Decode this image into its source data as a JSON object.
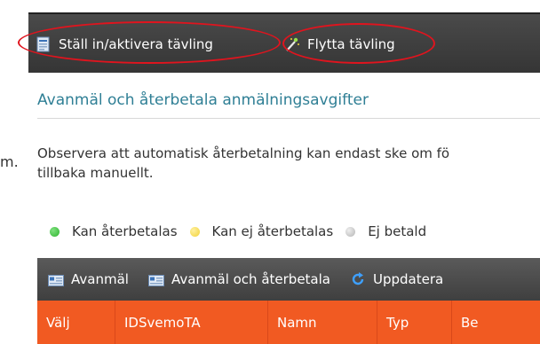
{
  "topbar": {
    "buttons": [
      {
        "label": "Ställ in/aktivera tävling",
        "icon": "form-icon"
      },
      {
        "label": "Flytta tävling",
        "icon": "magic-wand-icon"
      }
    ]
  },
  "section": {
    "heading": "Avanmäl och återbetala anmälningsavgifter",
    "stray_text": "m.",
    "notice_line1": "Observera att automatisk återbetalning kan endast ske om fö",
    "notice_line2": "tillbaka manuellt."
  },
  "legend": [
    {
      "label": "Kan återbetalas",
      "color": "#2fb52f"
    },
    {
      "label": "Kan ej återbetalas",
      "color": "#f2d236"
    },
    {
      "label": "Ej betald",
      "color": "#c0c0c0"
    }
  ],
  "toolbar": {
    "buttons": [
      {
        "label": "Avanmäl",
        "icon": "card-icon"
      },
      {
        "label": "Avanmäl och återbetala",
        "icon": "card-icon"
      },
      {
        "label": "Uppdatera",
        "icon": "refresh-icon"
      }
    ]
  },
  "grid": {
    "columns": [
      "Välj",
      "IDSvemoTA",
      "Namn",
      "Typ",
      "Be"
    ]
  },
  "colors": {
    "heading": "#2f7f95",
    "grid_header": "#f15a22",
    "toolbar_dark": "#4a4a4a",
    "highlight_ellipse": "#e0141e"
  }
}
